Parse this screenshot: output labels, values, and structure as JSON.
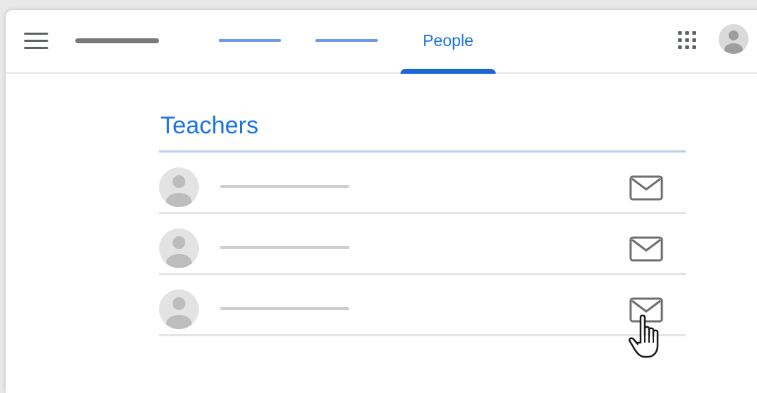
{
  "header": {
    "tabs": [
      {
        "label": ""
      },
      {
        "label": ""
      },
      {
        "label": "People",
        "active": true
      }
    ],
    "icons": {
      "menu": "hamburger-menu-icon",
      "apps": "apps-grid-icon",
      "account": "account-avatar-icon"
    }
  },
  "teachers": {
    "title": "Teachers",
    "rows": [
      {
        "name": "",
        "action_icon": "mail-icon"
      },
      {
        "name": "",
        "action_icon": "mail-icon"
      },
      {
        "name": "",
        "action_icon": "mail-icon"
      }
    ]
  },
  "colors": {
    "accent": "#1a73e8",
    "tab_placeholder": "#6c9bea",
    "divider": "#e5e5e5"
  },
  "cursor": "pointer-hand-icon"
}
